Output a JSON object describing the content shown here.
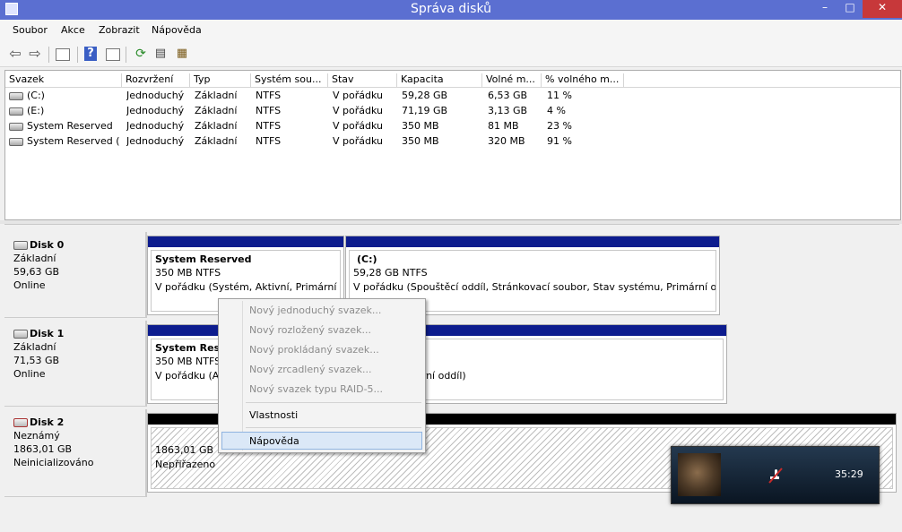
{
  "window": {
    "title": "Správa disků",
    "min": "–",
    "max": "□",
    "close": "✕"
  },
  "menu": [
    "Soubor",
    "Akce",
    "Zobrazit",
    "Nápověda"
  ],
  "toolbar": [
    "back-icon",
    "forward-icon",
    "console-tree-icon",
    "help-icon",
    "action-pane-icon",
    "refresh-icon",
    "rescan-icon",
    "properties-icon"
  ],
  "volume_list": {
    "headers": [
      "Svazek",
      "Rozvržení",
      "Typ",
      "Systém sou...",
      "Stav",
      "Kapacita",
      "Volné m...",
      "% volného m..."
    ],
    "rows": [
      [
        "(C:)",
        "Jednoduchý",
        "Základní",
        "NTFS",
        "V pořádku",
        "59,28 GB",
        "6,53 GB",
        "11 %"
      ],
      [
        "(E:)",
        "Jednoduchý",
        "Základní",
        "NTFS",
        "V pořádku",
        "71,19 GB",
        "3,13 GB",
        "4 %"
      ],
      [
        "System Reserved",
        "Jednoduchý",
        "Základní",
        "NTFS",
        "V pořádku",
        "350 MB",
        "81 MB",
        "23 %"
      ],
      [
        "System Reserved (...",
        "Jednoduchý",
        "Základní",
        "NTFS",
        "V pořádku",
        "350 MB",
        "320 MB",
        "91 %"
      ]
    ]
  },
  "disks": [
    {
      "name": "Disk 0",
      "type": "Základní",
      "size": "59,63 GB",
      "status": "Online"
    },
    {
      "name": "Disk 1",
      "type": "Základní",
      "size": "71,53 GB",
      "status": "Online"
    },
    {
      "name": "Disk 2",
      "type": "Neznámý",
      "size": "1863,01 GB",
      "status": "Neinicializováno"
    }
  ],
  "partitions": {
    "d0p1": {
      "name": "System Reserved",
      "fs": "350 MB NTFS",
      "status": "V pořádku (Systém, Aktivní, Primární oddíl)"
    },
    "d0p2": {
      "name": "(C:)",
      "fs": "59,28 GB NTFS",
      "status": "V pořádku (Spouštěcí oddíl, Stránkovací soubor, Stav systému, Primární oddíl)"
    },
    "d1p1": {
      "name": "System Reserved",
      "fs": "350 MB NTFS",
      "status": "V pořádku (Aktivní, Primární oddíl)"
    },
    "d1p2": {
      "status_tail": "ární oddíl)"
    },
    "d2p1": {
      "size": "1863,01 GB",
      "status": "Nepřiřazeno"
    }
  },
  "context_menu": {
    "items": [
      "Nový jednoduchý svazek...",
      "Nový rozložený svazek...",
      "Nový prokládaný svazek...",
      "Nový zrcadlený svazek...",
      "Nový svazek typu RAID-5..."
    ],
    "properties": "Vlastnosti",
    "help": "Nápověda"
  },
  "media_player": {
    "time": "35:29"
  },
  "colors": {
    "titlebar": "#5b6fd1",
    "partition_bar": "#0d1c8e",
    "unallocated_bar": "#000000",
    "highlight": "#dbe8f7"
  }
}
